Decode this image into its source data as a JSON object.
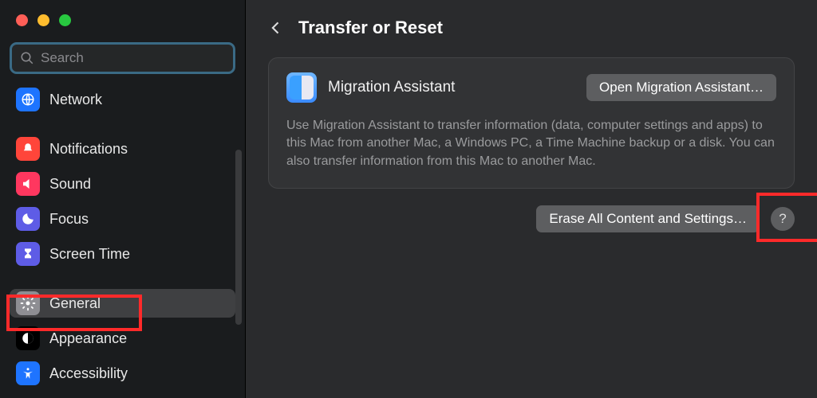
{
  "window": {
    "search_placeholder": "Search"
  },
  "sidebar": {
    "items": [
      {
        "label": "Network",
        "icon": "globe-icon",
        "bg": "#1e74ff"
      },
      {
        "label": "Notifications",
        "icon": "bell-icon",
        "bg": "#ff453a"
      },
      {
        "label": "Sound",
        "icon": "speaker-icon",
        "bg": "#ff375f"
      },
      {
        "label": "Focus",
        "icon": "moon-icon",
        "bg": "#5e5ce6"
      },
      {
        "label": "Screen Time",
        "icon": "hourglass-icon",
        "bg": "#5e5ce6"
      },
      {
        "label": "General",
        "icon": "gear-icon",
        "bg": "#8e8e93",
        "selected": true
      },
      {
        "label": "Appearance",
        "icon": "appearance-icon",
        "bg": "#000000"
      },
      {
        "label": "Accessibility",
        "icon": "accessibility-icon",
        "bg": "#1e74ff"
      }
    ]
  },
  "main": {
    "title": "Transfer or Reset",
    "panel": {
      "label": "Migration Assistant",
      "button": "Open Migration Assistant…",
      "description": "Use Migration Assistant to transfer information (data, computer settings and apps) to this Mac from another Mac, a Windows PC, a Time Machine backup or a disk. You can also transfer information from this Mac to another Mac."
    },
    "erase_button": "Erase All Content and Settings…",
    "help_label": "?"
  }
}
